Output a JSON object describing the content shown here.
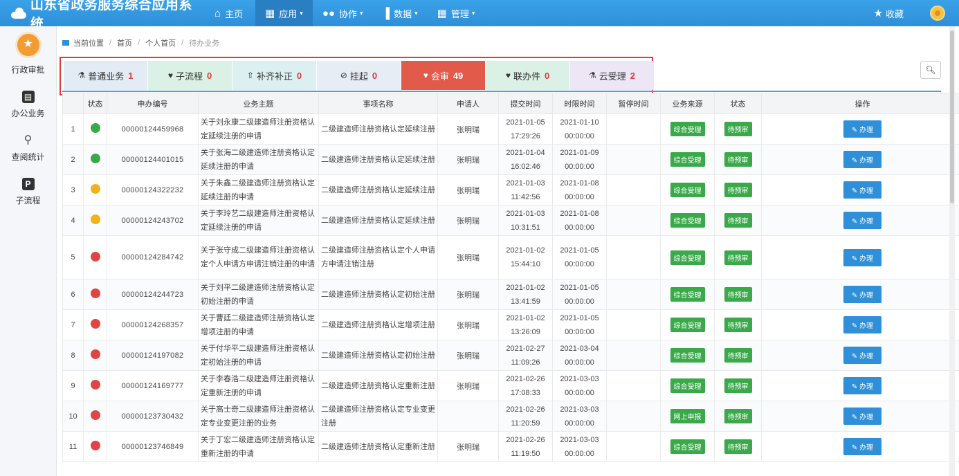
{
  "app": {
    "title": "山东省政务服务综合应用系统"
  },
  "nav": {
    "items": [
      {
        "label": "主页",
        "icon": "home-icon",
        "glyph": "⌂",
        "caret": ""
      },
      {
        "label": "应用",
        "icon": "grid-icon",
        "glyph": "▦",
        "caret": "▾"
      },
      {
        "label": "协作",
        "icon": "toggle-icon",
        "glyph": "●●",
        "caret": "▾"
      },
      {
        "label": "数据",
        "icon": "bar-chart-icon",
        "glyph": "▐",
        "caret": "▾"
      },
      {
        "label": "管理",
        "icon": "modules-icon",
        "glyph": "▦",
        "caret": "▾"
      }
    ],
    "favorites_label": "收藏"
  },
  "sidebar": {
    "items": [
      {
        "label": "行政审批",
        "icon": "badge-icon"
      },
      {
        "label": "办公业务",
        "icon": "document-icon",
        "glyph": "▤"
      },
      {
        "label": "查阅统计",
        "icon": "search-icon",
        "glyph": "⚲"
      },
      {
        "label": "子流程",
        "icon": "p-icon",
        "glyph": "P"
      }
    ]
  },
  "breadcrumb": {
    "label": "当前位置",
    "items": [
      "首页",
      "个人首页",
      "待办业务"
    ]
  },
  "tabs": [
    {
      "label": "普通业务",
      "count": "1",
      "icon": "flask-icon",
      "glyph": "⚗",
      "color": "#e3ebf4"
    },
    {
      "label": "子流程",
      "count": "0",
      "icon": "bird-icon",
      "glyph": "♥",
      "color": "#dcf1e6"
    },
    {
      "label": "补齐补正",
      "count": "0",
      "icon": "upload-icon",
      "glyph": "⇧",
      "color": "#dcf0f1"
    },
    {
      "label": "挂起",
      "count": "0",
      "icon": "clip-icon",
      "glyph": "⊘",
      "color": "#e7edf5"
    },
    {
      "label": "会审",
      "count": "49",
      "icon": "bird-icon",
      "glyph": "♥",
      "color": "#e15a4a"
    },
    {
      "label": "联办件",
      "count": "0",
      "icon": "bird-icon",
      "glyph": "♥",
      "color": "#dcf1e6"
    },
    {
      "label": "云受理",
      "count": "2",
      "icon": "flask-icon",
      "glyph": "⚗",
      "color": "#ece6f5"
    }
  ],
  "table": {
    "headers": [
      "",
      "状态",
      "申办编号",
      "业务主题",
      "事项名称",
      "申请人",
      "提交时间",
      "时限时间",
      "暂停时间",
      "业务来源",
      "状态",
      "操作"
    ],
    "status_colors": {
      "green": "#3aa94a",
      "yellow": "#f2b21b",
      "red": "#e04545"
    },
    "rows": [
      {
        "n": "1",
        "status": "green",
        "code": "00000124459968",
        "subject": "关于刘永康二级建造师注册资格认定延续注册的申请",
        "item": "二级建造师注册资格认定延续注册",
        "applicant": "张明瑞",
        "submit": [
          "2021-01-05",
          "17:29:26"
        ],
        "limit": [
          "2021-01-10",
          "00:00:00"
        ],
        "pause": "",
        "source": "综合受理",
        "state": "待预审",
        "action": "办理",
        "h": 2
      },
      {
        "n": "2",
        "status": "green",
        "code": "00000124401015",
        "subject": "关于张海二级建造师注册资格认定延续注册的申请",
        "item": "二级建造师注册资格认定延续注册",
        "applicant": "张明瑞",
        "submit": [
          "2021-01-04",
          "16:02:46"
        ],
        "limit": [
          "2021-01-09",
          "00:00:00"
        ],
        "pause": "",
        "source": "综合受理",
        "state": "待预审",
        "action": "办理",
        "h": 2
      },
      {
        "n": "3",
        "status": "yellow",
        "code": "00000124322232",
        "subject": "关于朱鑫二级建造师注册资格认定延续注册的申请",
        "item": "二级建造师注册资格认定延续注册",
        "applicant": "张明瑞",
        "submit": [
          "2021-01-03",
          "11:42:56"
        ],
        "limit": [
          "2021-01-08",
          "00:00:00"
        ],
        "pause": "",
        "source": "综合受理",
        "state": "待预审",
        "action": "办理",
        "h": 2
      },
      {
        "n": "4",
        "status": "yellow",
        "code": "00000124243702",
        "subject": "关于李玲艺二级建造师注册资格认定延续注册的申请",
        "item": "二级建造师注册资格认定延续注册",
        "applicant": "张明瑞",
        "submit": [
          "2021-01-03",
          "10:31:51"
        ],
        "limit": [
          "2021-01-08",
          "00:00:00"
        ],
        "pause": "",
        "source": "综合受理",
        "state": "待预审",
        "action": "办理",
        "h": 2
      },
      {
        "n": "5",
        "status": "red",
        "code": "00000124284742",
        "subject": "关于张守成二级建造师注册资格认定个人申请方申请注销注册的申请",
        "item": "二级建造师注册资格认定个人申请方申请注销注册",
        "applicant": "张明瑞",
        "submit": [
          "2021-01-02",
          "15:44:10"
        ],
        "limit": [
          "2021-01-05",
          "00:00:00"
        ],
        "pause": "",
        "source": "综合受理",
        "state": "待预审",
        "action": "办理",
        "h": 3
      },
      {
        "n": "6",
        "status": "red",
        "code": "00000124244723",
        "subject": "关于刘平二级建造师注册资格认定初始注册的申请",
        "item": "二级建造师注册资格认定初始注册",
        "applicant": "张明瑞",
        "submit": [
          "2021-01-02",
          "13:41:59"
        ],
        "limit": [
          "2021-01-05",
          "00:00:00"
        ],
        "pause": "",
        "source": "综合受理",
        "state": "待预审",
        "action": "办理",
        "h": 2
      },
      {
        "n": "7",
        "status": "red",
        "code": "00000124268357",
        "subject": "关于曹廷二级建造师注册资格认定增项注册的申请",
        "item": "二级建造师注册资格认定增项注册",
        "applicant": "张明瑞",
        "submit": [
          "2021-01-02",
          "13:26:09"
        ],
        "limit": [
          "2021-01-05",
          "00:00:00"
        ],
        "pause": "",
        "source": "综合受理",
        "state": "待预审",
        "action": "办理",
        "h": 2
      },
      {
        "n": "8",
        "status": "red",
        "code": "00000124197082",
        "subject": "关于付华平二级建造师注册资格认定初始注册的申请",
        "item": "二级建造师注册资格认定初始注册",
        "applicant": "张明瑞",
        "submit": [
          "2021-02-27",
          "11:09:26"
        ],
        "limit": [
          "2021-03-04",
          "00:00:00"
        ],
        "pause": "",
        "source": "综合受理",
        "state": "待预审",
        "action": "办理",
        "h": 2
      },
      {
        "n": "9",
        "status": "red",
        "code": "00000124169777",
        "subject": "关于李春浩二级建造师注册资格认定重新注册的申请",
        "item": "二级建造师注册资格认定重新注册",
        "applicant": "张明瑞",
        "submit": [
          "2021-02-26",
          "17:08:33"
        ],
        "limit": [
          "2021-03-03",
          "00:00:00"
        ],
        "pause": "",
        "source": "综合受理",
        "state": "待预审",
        "action": "办理",
        "h": 2
      },
      {
        "n": "10",
        "status": "red",
        "code": "00000123730432",
        "subject": "关于高士奇二级建造师注册资格认定专业变更注册的业务",
        "item": "二级建造师注册资格认定专业变更注册",
        "applicant": "",
        "submit": [
          "2021-02-26",
          "11:20:59"
        ],
        "limit": [
          "2021-03-03",
          "00:00:00"
        ],
        "pause": "",
        "source": "网上申报",
        "state": "待预审",
        "action": "办理",
        "h": 2
      },
      {
        "n": "11",
        "status": "red",
        "code": "00000123746849",
        "subject": "关于丁宏二级建造师注册资格认定重新注册的申请",
        "item": "二级建造师注册资格认定重新注册",
        "applicant": "张明瑞",
        "submit": [
          "2021-02-26",
          "11:19:50"
        ],
        "limit": [
          "2021-03-03",
          "00:00:00"
        ],
        "pause": "",
        "source": "综合受理",
        "state": "待预审",
        "action": "办理",
        "h": 2
      }
    ]
  }
}
